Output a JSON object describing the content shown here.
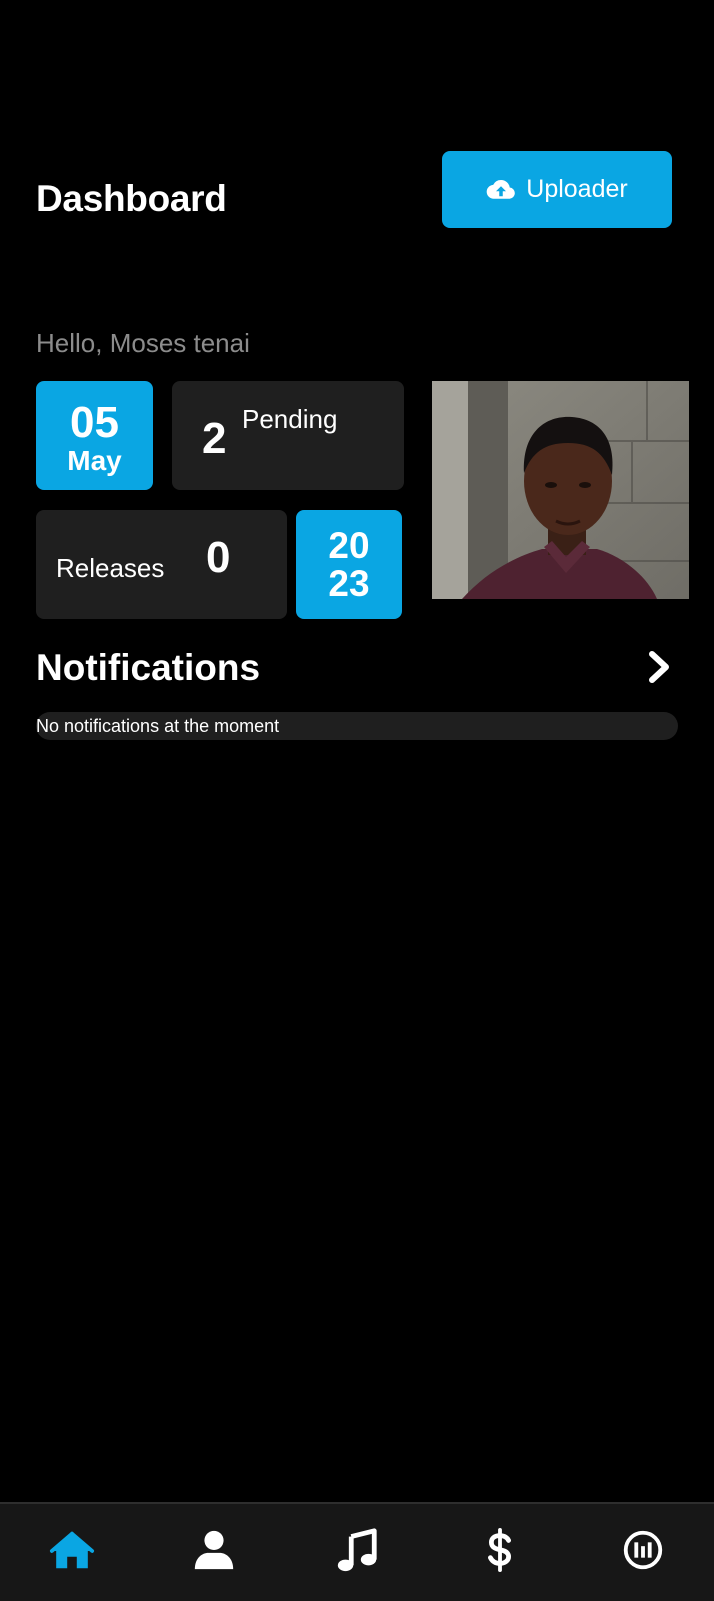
{
  "header": {
    "title": "Dashboard",
    "uploader_label": "Uploader"
  },
  "greeting": "Hello, Moses tenai",
  "stats": {
    "date_day": "05",
    "date_month": "May",
    "pending_count": "2",
    "pending_label": "Pending",
    "releases_label": "Releases",
    "releases_count": "0",
    "year_line1": "20",
    "year_line2": "23"
  },
  "notifications": {
    "title": "Notifications",
    "empty_message": "No notifications at the moment"
  },
  "bottom_nav": {
    "items": [
      {
        "icon": "home-icon",
        "active": true
      },
      {
        "icon": "user-icon",
        "active": false
      },
      {
        "icon": "music-note-icon",
        "active": false
      },
      {
        "icon": "dollar-icon",
        "active": false
      },
      {
        "icon": "brand-logo-icon",
        "active": false
      }
    ]
  },
  "colors": {
    "accent": "#0aa6e3",
    "background": "#000000",
    "tile": "#1f1f1f",
    "nav_bar": "#171717",
    "muted_text": "#8c8c8c"
  }
}
